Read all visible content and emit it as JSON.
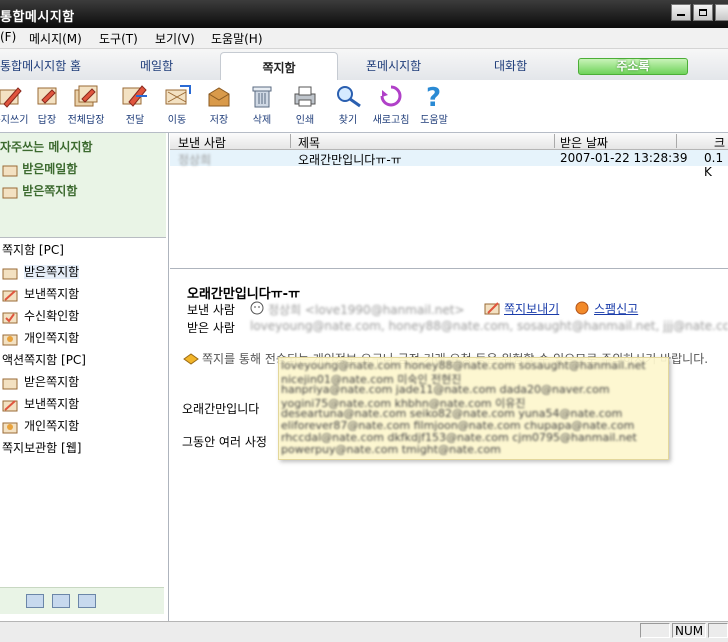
{
  "window": {
    "title": "통합메시지함"
  },
  "menu": {
    "items": [
      "(F)",
      "메시지(M)",
      "도구(T)",
      "보기(V)",
      "도움말(H)"
    ]
  },
  "tabs": {
    "items": [
      "통합메시지함 홈",
      "메일함",
      "쪽지함",
      "폰메시지함",
      "대화함"
    ],
    "active_index": 2,
    "address_button": "주소록"
  },
  "toolbar": {
    "items": [
      {
        "label": "쪽지쓰기",
        "icon": "write-icon"
      },
      {
        "label": "답장",
        "icon": "reply-icon"
      },
      {
        "label": "전체답장",
        "icon": "reply-all-icon"
      },
      {
        "label": "전달",
        "icon": "forward-icon"
      },
      {
        "label": "이동",
        "icon": "move-icon"
      },
      {
        "label": "저장",
        "icon": "save-icon"
      },
      {
        "label": "삭제",
        "icon": "trash-icon"
      },
      {
        "label": "인쇄",
        "icon": "print-icon"
      },
      {
        "label": "찾기",
        "icon": "search-icon"
      },
      {
        "label": "새로고침",
        "icon": "refresh-icon"
      },
      {
        "label": "도움말",
        "icon": "help-icon"
      }
    ]
  },
  "left": {
    "favorites_header": "자주쓰는 메시지함",
    "favorites": [
      "받은메일함",
      "받은쪽지함"
    ],
    "tree": [
      {
        "label": "쪽지함 [PC]",
        "indent": false
      },
      {
        "label": "받은쪽지함",
        "indent": true
      },
      {
        "label": "보낸쪽지함",
        "indent": true
      },
      {
        "label": "수신확인함",
        "indent": true
      },
      {
        "label": "개인쪽지함",
        "indent": true
      },
      {
        "label": "액션쪽지함 [PC]",
        "indent": false
      },
      {
        "label": "받은쪽지함",
        "indent": true
      },
      {
        "label": "보낸쪽지함",
        "indent": true
      },
      {
        "label": "개인쪽지함",
        "indent": true
      },
      {
        "label": "쪽지보관함 [웹]",
        "indent": false
      }
    ]
  },
  "list": {
    "columns": [
      "보낸 사람",
      "제목",
      "받은 날짜",
      "크"
    ],
    "rows": [
      {
        "sender": "정상희",
        "subject": "오래간만입니다ㅠ-ㅠ",
        "date": "2007-01-22 13:28:39",
        "size": "0.1 K"
      }
    ]
  },
  "reader": {
    "subject": "오래간만입니다ㅠ-ㅠ",
    "from_label": "보낸 사람",
    "from_value": "정상희 <love1990@hanmail.net>",
    "to_label": "받은 사람",
    "to_value": "loveyoung@nate.com, honey88@nate.com, sosaught@hanmail.net, jjj@nate.com",
    "send_note_label": "쪽지보내기",
    "spam_label": "스팸신고",
    "warning_text": "쪽지를 통해 전송되는 개인정보 요구나 금전 거래 요청 등은 위험할 수 있으므로 주의하시기 바랍니다.",
    "body_lines": [
      "오래간만입니다",
      "그동안 여러 사정"
    ]
  },
  "popup": {
    "lines": [
      "loveyoung@nate.com honey88@nate.com sosaught@hanmail.net",
      "nicejin01@nate.com 미숙인 전현진",
      "hanpriya@nate.com jade11@nate.com dada20@naver.com",
      "yogini75@nate.com khbhn@nate.com 이유진",
      "deseartuna@nate.com seiko82@nate.com yuna54@nate.com",
      "eliforever87@nate.com filmjoon@nate.com chupapa@nate.com",
      "rhccdal@nate.com dkfkdjf153@nate.com cjm0795@hanmail.net",
      "powerpuy@nate.com tmight@nate.com"
    ]
  },
  "status": {
    "num": "NUM"
  }
}
